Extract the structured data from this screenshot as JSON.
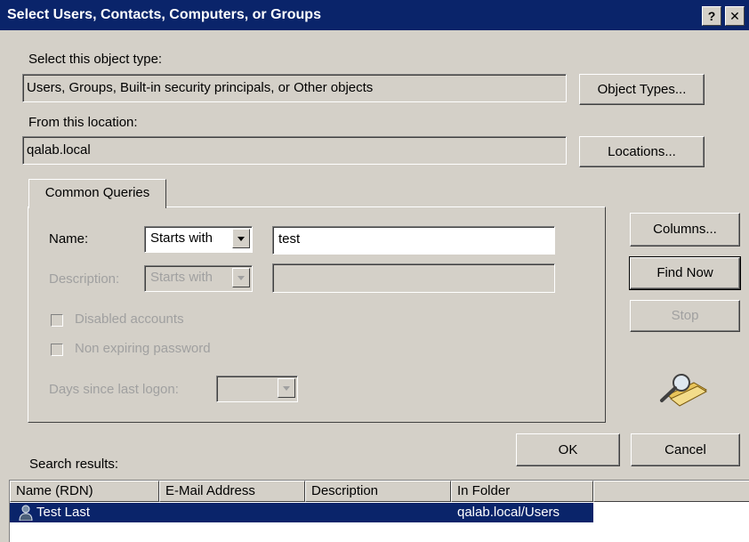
{
  "window": {
    "title": "Select Users, Contacts, Computers, or Groups",
    "help_label": "?",
    "close_label": "✕"
  },
  "object_type": {
    "label": "Select this object type:",
    "value": "Users, Groups, Built-in security principals, or Other objects",
    "button": "Object Types..."
  },
  "location": {
    "label": "From this location:",
    "value": "qalab.local",
    "button": "Locations..."
  },
  "queries": {
    "tab": "Common Queries",
    "name_label": "Name:",
    "name_mode": "Starts with",
    "name_value": "test",
    "description_label": "Description:",
    "description_mode": "Starts with",
    "description_value": "",
    "disabled_accounts": "Disabled accounts",
    "non_expiring": "Non expiring password",
    "days_label": "Days since last logon:",
    "days_value": ""
  },
  "side_buttons": {
    "columns": "Columns...",
    "find_now": "Find Now",
    "stop": "Stop"
  },
  "footer": {
    "ok": "OK",
    "cancel": "Cancel",
    "search_results_label": "Search results:"
  },
  "results": {
    "columns": [
      "Name (RDN)",
      "E-Mail Address",
      "Description",
      "In Folder"
    ],
    "rows": [
      {
        "name": "Test Last",
        "email": "",
        "description": "",
        "folder": "qalab.local/Users",
        "selected": true
      }
    ]
  },
  "colors": {
    "titlebar": "#0a246a",
    "dialog_bg": "#d4d0c8",
    "selection": "#0a246a"
  }
}
